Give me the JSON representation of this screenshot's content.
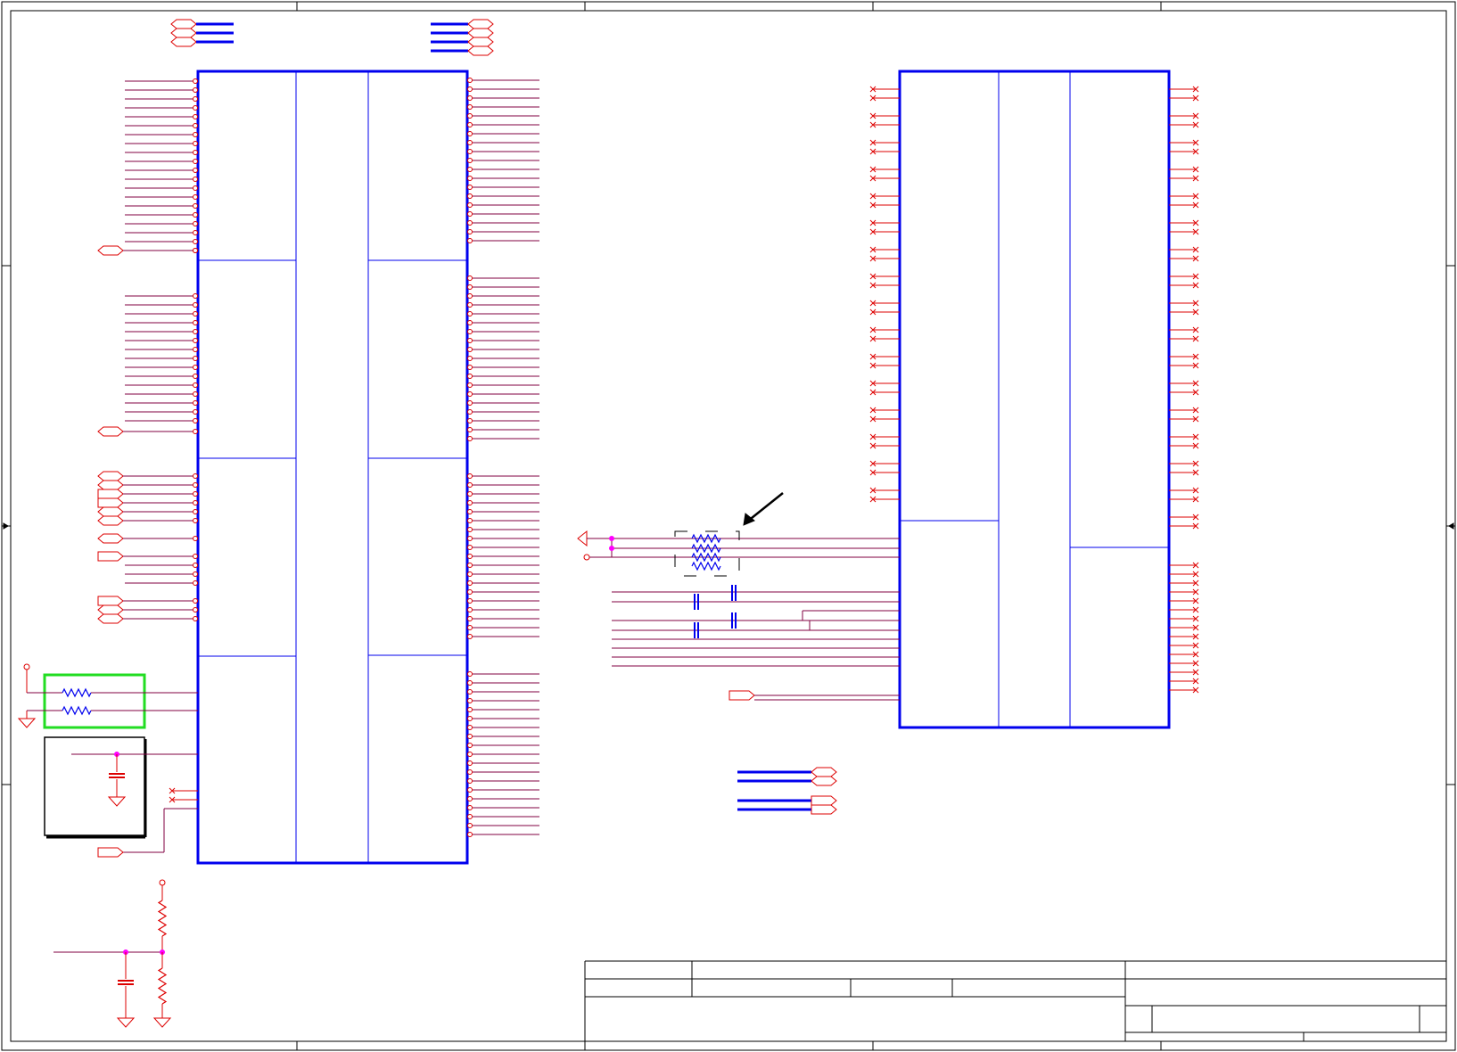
{
  "document": {
    "type": "schematic",
    "colors": {
      "frame": "#000000",
      "component_outline": "#0000ee",
      "wire": "#dd0000",
      "net_wire": "#800040",
      "junction": "#ff00ff",
      "highlight_box": "#22dd22",
      "resistor": "#0000ee",
      "arrow": "#000000"
    },
    "icons": {
      "ground": "ground-symbol-icon",
      "power": "power-pin-icon",
      "port": "hex-port-icon",
      "no_connect": "no-connect-x-icon",
      "resistor": "resistor-zigzag-icon",
      "capacitor": "capacitor-icon",
      "pointer": "pointer-arrow-icon"
    },
    "title_block": {
      "title": "",
      "size": "",
      "document_number": "",
      "revision": "",
      "date": "",
      "sheet": ""
    }
  }
}
